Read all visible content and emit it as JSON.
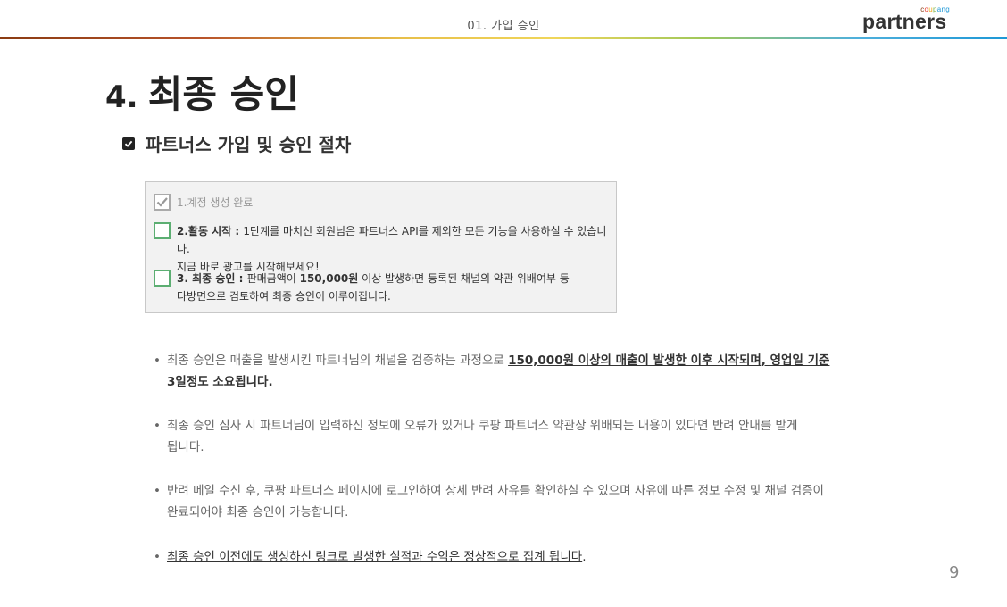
{
  "header": {
    "title": "01.  가입 승인",
    "brand_small": [
      "c",
      "o",
      "u",
      "p",
      "a",
      "n",
      "g"
    ],
    "brand_main": "partners"
  },
  "page": {
    "title_number": "4.",
    "title_text": "최종 승인",
    "number": "9"
  },
  "section": {
    "label": "파트너스 가입 및 승인 절차"
  },
  "steps": [
    {
      "line1_bold": "",
      "line1": "1.계정 생성 완료",
      "line2": ""
    },
    {
      "line1_bold": "2.활동 시작 : ",
      "line1": "1단계를 마치신 회원님은 파트너스 API를 제외한 모든 기능을 사용하실 수 있습니다.",
      "line2": "지금 바로 광고를 시작해보세요!"
    },
    {
      "line1_bold": "3. 최종 승인 : ",
      "line1_pre": "판매금액이 ",
      "line1_amount": "150,000원",
      "line1": " 이상 발생하면 등록된 채널의 약관 위배여부 등",
      "line2": "다방면으로 검토하여 최종 승인이 이루어집니다."
    }
  ],
  "bullets": [
    {
      "text": "최종 승인은 매출을 발생시킨 파트너님의 채널을 검증하는 과정으로 ",
      "emph": "150,000원 이상의 매출이 발생한 이후 시작되며, 영업일 기준",
      "emph2": "3일정도 소요됩니다."
    },
    {
      "text": "최종 승인 심사 시 파트너님이 입력하신 정보에 오류가 있거나 쿠팡 파트너스 약관상 위배되는 내용이 있다면 반려 안내를 받게",
      "text2": "됩니다."
    },
    {
      "text": "반려 메일 수신 후, 쿠팡 파트너스 페이지에 로그인하여 상세 반려 사유를 확인하실 수 있으며 사유에 따른 정보 수정 및 채널 검증이",
      "text2": "완료되어야 최종 승인이 가능합니다."
    },
    {
      "emph": "최종 승인 이전에도 생성하신 링크로 발생한 실적과 수익은 정상적으로 집계 됩니다",
      "tail": "."
    }
  ],
  "bullet_symbol": "•"
}
